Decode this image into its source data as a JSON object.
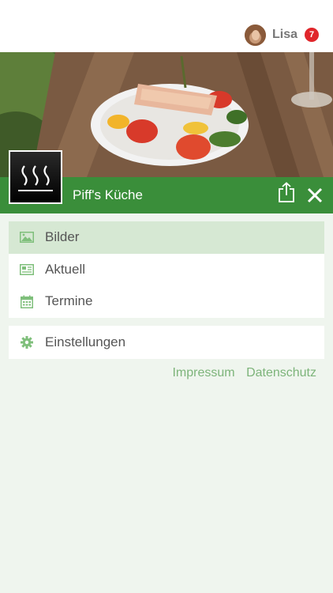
{
  "header": {
    "user_name": "Lisa",
    "notification_count": "7"
  },
  "title_bar": {
    "title": "Piff's Küche"
  },
  "menu": {
    "items": [
      {
        "label": "Bilder",
        "icon": "image-icon",
        "active": true
      },
      {
        "label": "Aktuell",
        "icon": "newspaper-icon",
        "active": false
      },
      {
        "label": "Termine",
        "icon": "calendar-icon",
        "active": false
      }
    ],
    "settings_label": "Einstellungen"
  },
  "footer": {
    "impressum": "Impressum",
    "datenschutz": "Datenschutz"
  },
  "colors": {
    "accent_green": "#3a8e3a",
    "active_item_bg": "#d6e8d3",
    "icon_green": "#7fbf7b",
    "badge_red": "#e0262b",
    "background": "#eff5ee"
  }
}
